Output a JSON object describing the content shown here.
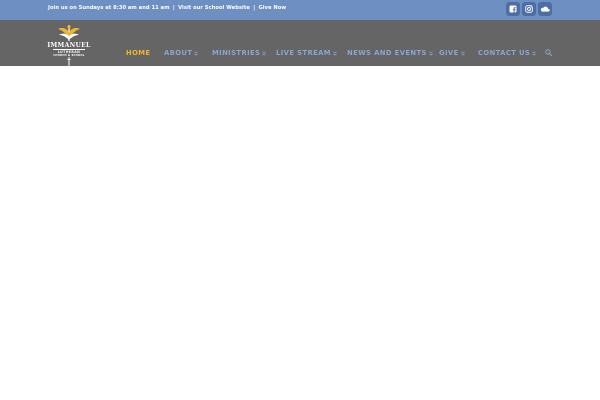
{
  "topbar": {
    "intro": "Join us on Sundays at 8:30 am and 11 am",
    "school_link": "Visit our School Website",
    "give_link": "Give Now",
    "separator": "|",
    "social": [
      "square-facebook-icon",
      "instagram-icon",
      "soundcloud-icon"
    ]
  },
  "logo": {
    "name": "IMMANUEL",
    "line1": "LUTHERAN",
    "line2": "CHURCH & SCHOOL"
  },
  "nav": {
    "items": [
      {
        "label": "HOME",
        "active": true,
        "has_dropdown": false
      },
      {
        "label": "ABOUT",
        "active": false,
        "has_dropdown": true
      },
      {
        "label": "MINISTRIES",
        "active": false,
        "has_dropdown": true
      },
      {
        "label": "LIVE STREAM",
        "active": false,
        "has_dropdown": true
      },
      {
        "label": "NEWS AND EVENTS",
        "active": false,
        "has_dropdown": true
      },
      {
        "label": "GIVE",
        "active": false,
        "has_dropdown": true
      },
      {
        "label": "CONTACT US",
        "active": false,
        "has_dropdown": true
      }
    ],
    "search_icon": "search-icon"
  },
  "colors": {
    "topbar_bg": "#6e8fc1",
    "navbar_bg": "#656565",
    "nav_link": "#8aa4d6",
    "nav_active": "#f1b52c",
    "social_bg": "#4c6ea5"
  }
}
